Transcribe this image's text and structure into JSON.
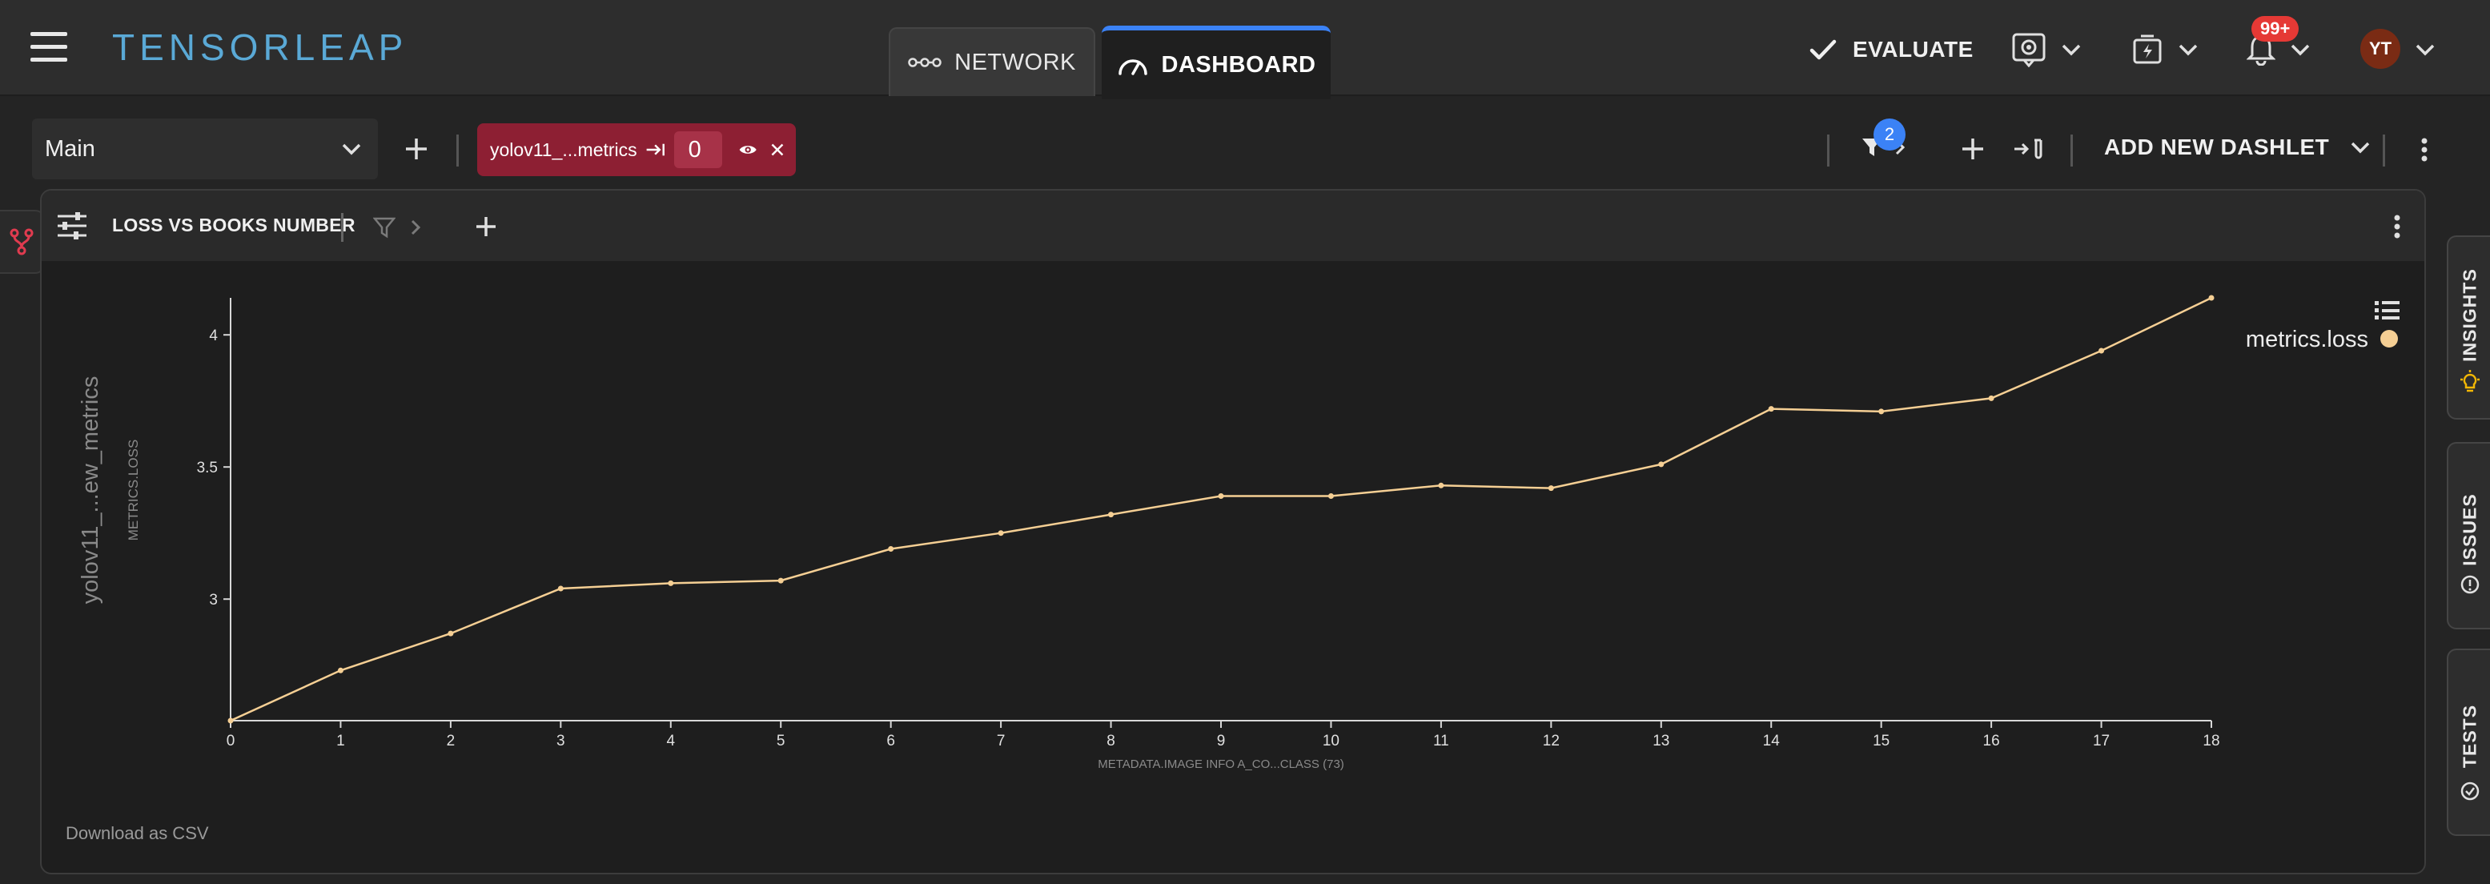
{
  "header": {
    "logo_text": "TENSORLEAP",
    "tabs": [
      {
        "label": "NETWORK",
        "icon": "network-icon",
        "active": false
      },
      {
        "label": "DASHBOARD",
        "icon": "speedometer-icon",
        "active": true
      }
    ],
    "evaluate_label": "EVALUATE",
    "notification_badge": "99+",
    "avatar_initials": "YT"
  },
  "toolbar": {
    "dashboard_select": "Main",
    "filter_chip": {
      "label": "yolov11_...metrics",
      "value": "0"
    },
    "filter_count": "2",
    "add_dashlet_label": "ADD NEW DASHLET"
  },
  "dashlet": {
    "title": "LOSS VS BOOKS NUMBER",
    "download_label": "Download as CSV"
  },
  "side_tabs": [
    "INSIGHTS",
    "ISSUES",
    "TESTS"
  ],
  "colors": {
    "accent": "#3b82f6",
    "chip": "#8d1f33",
    "series": "#f5cf94",
    "badge": "#e53935"
  },
  "chart_data": {
    "type": "line",
    "title": "",
    "ylabel_outer": "yolov11_...ew_metrics",
    "ylabel": "METRICS.LOSS",
    "xlabel": "METADATA.IMAGE INFO A_CO...CLASS (73)",
    "x": [
      0,
      1,
      2,
      3,
      4,
      5,
      6,
      7,
      8,
      9,
      10,
      11,
      12,
      13,
      14,
      15,
      16,
      17,
      18
    ],
    "xticks": [
      "0",
      "1",
      "2",
      "3",
      "4",
      "5",
      "6",
      "7",
      "8",
      "9",
      "10",
      "11",
      "12",
      "13",
      "14",
      "15",
      "16",
      "17",
      "18"
    ],
    "yticks": [
      "3",
      "3.5",
      "4"
    ],
    "ylim": [
      2.54,
      4.14
    ],
    "xlim": [
      0,
      18
    ],
    "series": [
      {
        "name": "metrics.loss",
        "color": "#f5cf94",
        "values": [
          2.54,
          2.73,
          2.87,
          3.04,
          3.06,
          3.07,
          3.19,
          3.25,
          3.32,
          3.39,
          3.39,
          3.43,
          3.42,
          3.51,
          3.72,
          3.71,
          3.76,
          3.94,
          4.14
        ]
      }
    ],
    "legend_position": "top-right",
    "grid": false
  }
}
